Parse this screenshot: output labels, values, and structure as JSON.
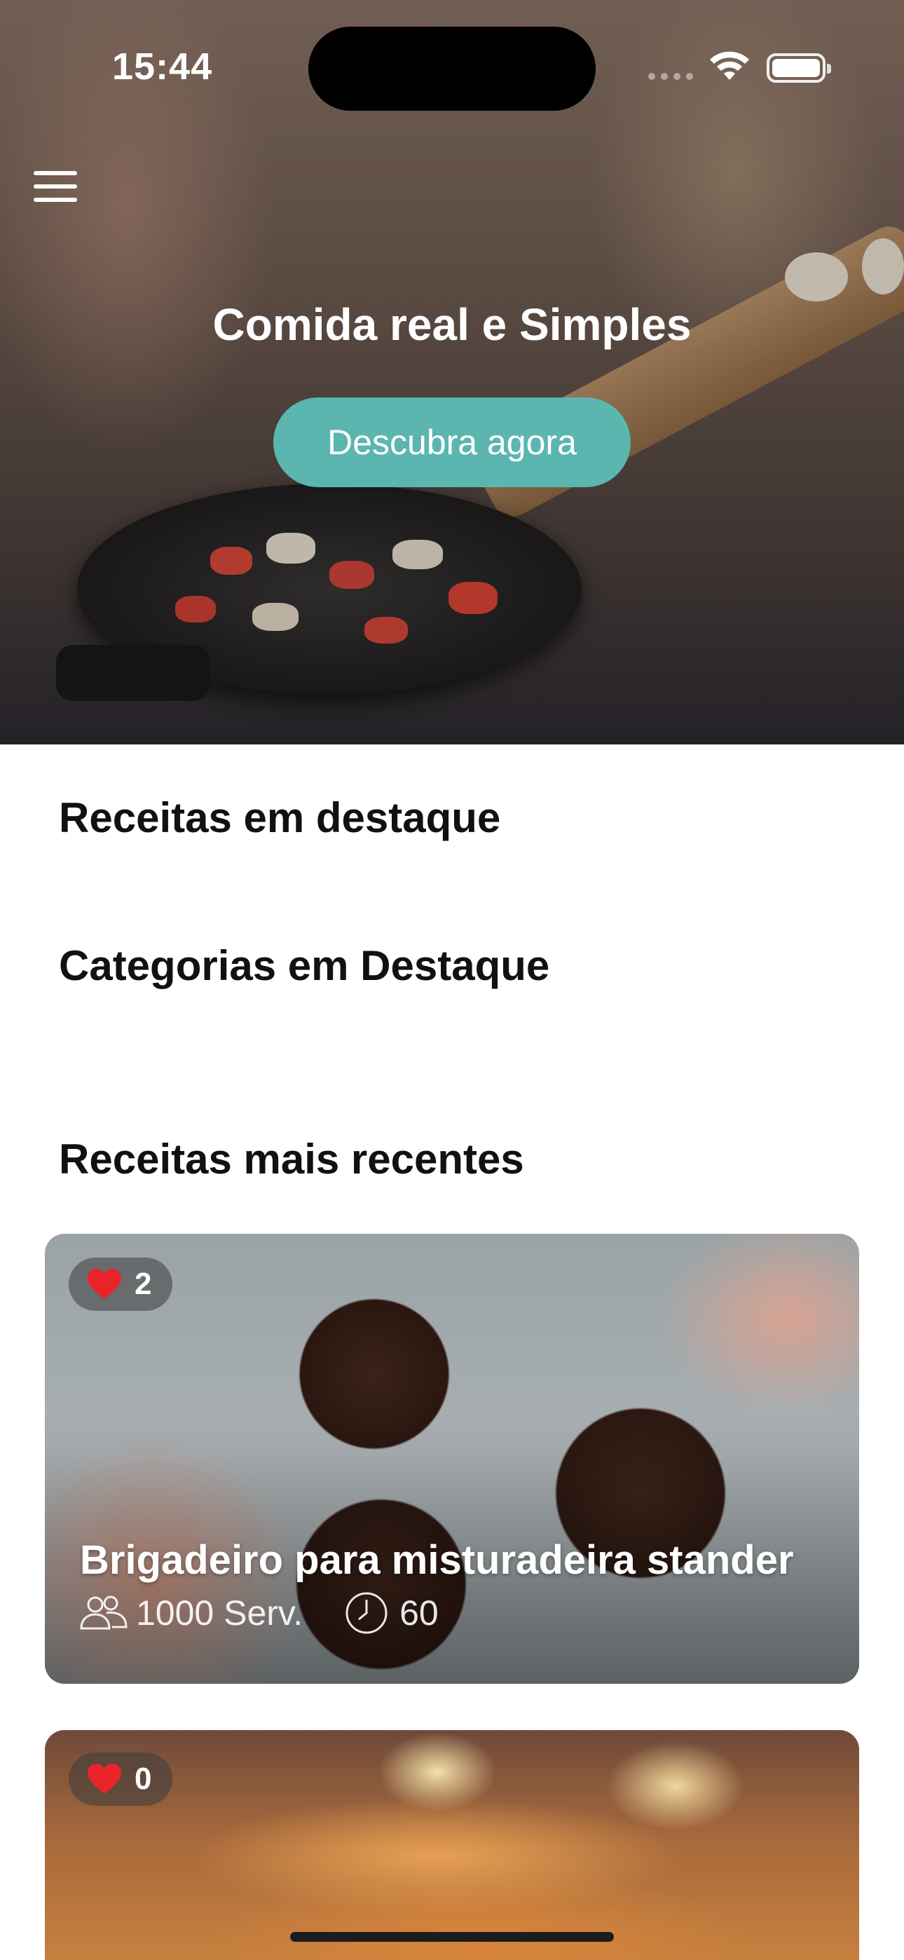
{
  "status_bar": {
    "time": "15:44"
  },
  "hero": {
    "title": "Comida real e Simples",
    "button_label": "Descubra agora",
    "button_color": "#5bb6b0"
  },
  "sections": {
    "featured_recipes": "Receitas em destaque",
    "featured_categories": "Categorias em Destaque",
    "recent_recipes": "Receitas mais recentes"
  },
  "recipes": [
    {
      "likes": "2",
      "title": "Brigadeiro para misturadeira stander",
      "servings": "1000 Serv.",
      "time": "60"
    },
    {
      "likes": "0"
    }
  ],
  "icons": {
    "menu": "hamburger-menu-icon",
    "like": "heart-icon",
    "servings": "people-icon",
    "time": "clock-icon",
    "wifi": "wifi-icon",
    "battery": "battery-icon"
  },
  "colors": {
    "accent": "#5bb6b0",
    "heart": "#e8242a",
    "text": "#111111"
  }
}
